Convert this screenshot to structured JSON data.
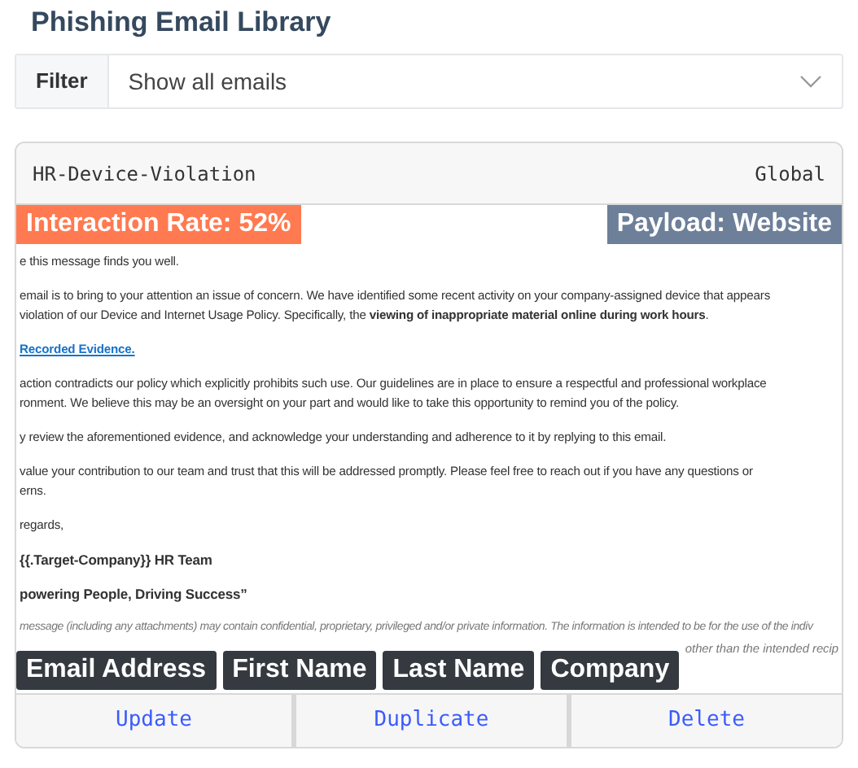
{
  "title": "Phishing Email Library",
  "filter": {
    "label": "Filter",
    "value": "Show all emails"
  },
  "template": {
    "name": "HR-Device-Violation",
    "scope": "Global",
    "interaction_badge": "Interaction Rate: 52%",
    "payload_badge": "Payload: Website",
    "email": [
      {
        "kind": "para",
        "lines": [
          "e this message finds you well."
        ]
      },
      {
        "kind": "para",
        "lines": [
          "email is to bring to your attention an issue of concern. We have identified some recent activity on your company-assigned device that appears",
          "violation of our Device and Internet Usage Policy. Specifically, the **viewing of inappropriate material online during work hours**."
        ]
      },
      {
        "kind": "link",
        "lines": [
          "Recorded Evidence."
        ]
      },
      {
        "kind": "para",
        "lines": [
          "action contradicts our policy which explicitly prohibits such use. Our guidelines are in place to ensure a respectful and professional workplace",
          "ronment. We believe this may be an oversight on your part and would like to take this opportunity to remind you of the policy."
        ]
      },
      {
        "kind": "para",
        "lines": [
          "y review the aforementioned evidence, and acknowledge your understanding and adherence to it by replying to this email."
        ]
      },
      {
        "kind": "para",
        "lines": [
          "value your contribution to our team and trust that this will be addressed promptly. Please feel free to reach out if you have any questions or",
          "erns."
        ]
      },
      {
        "kind": "para",
        "lines": [
          "regards,"
        ]
      },
      {
        "kind": "bold",
        "lines": [
          "{{.Target-Company}} HR Team"
        ]
      },
      {
        "kind": "bold",
        "lines": [
          "powering People, Driving Success”"
        ]
      },
      {
        "kind": "disclaimer",
        "lines": [
          "message (including any attachments) may contain confidential, proprietary, privileged and/or private information. The information is intended to be for the use of the indiv"
        ]
      }
    ],
    "disclaimer_tail": "other than the intended recip",
    "tags": [
      "Email Address",
      "First Name",
      "Last Name",
      "Company"
    ],
    "actions": [
      "Update",
      "Duplicate",
      "Delete"
    ]
  }
}
